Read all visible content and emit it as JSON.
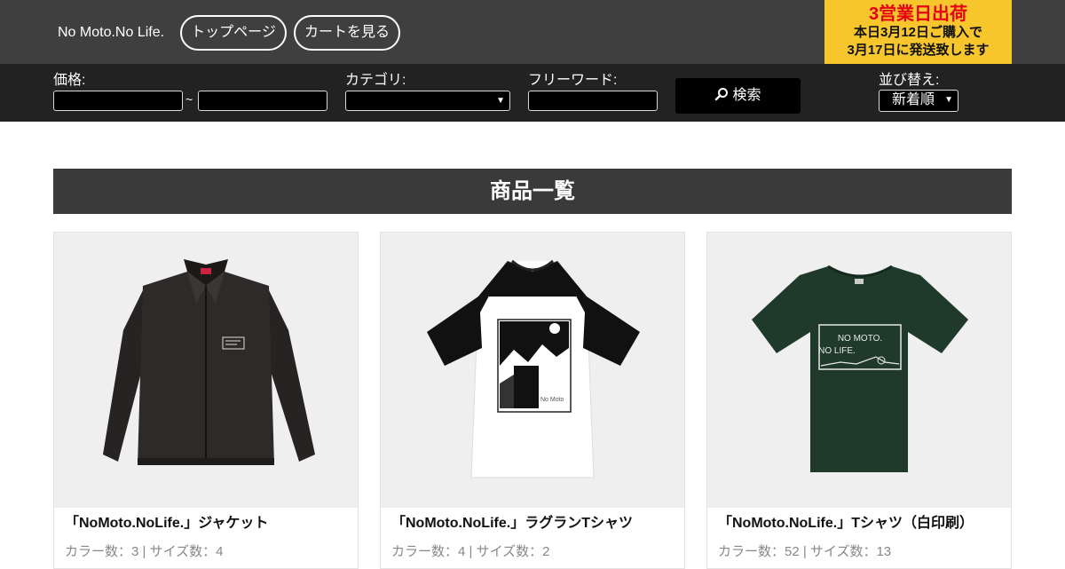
{
  "header": {
    "brand": "No Moto.No Life.",
    "nav": {
      "top_page": "トップページ",
      "view_cart": "カートを見る"
    },
    "promo": {
      "line1": "3営業日出荷",
      "line2": "本日3月12日ご購入で",
      "line3": "3月17日に発送致します"
    }
  },
  "search": {
    "price_label": "価格:",
    "price_separator": "~",
    "price_min_value": "",
    "price_max_value": "",
    "category_label": "カテゴリ:",
    "category_value": "",
    "freeword_label": "フリーワード:",
    "freeword_value": "",
    "search_button": "検索",
    "sort_label": "並び替え:",
    "sort_value": "新着順"
  },
  "main": {
    "section_title": "商品一覧",
    "products": [
      {
        "name": "「NoMoto.NoLife.」ジャケット",
        "meta": "カラー数：3 | サイズ数：4",
        "image_icon": "black-jacket-image"
      },
      {
        "name": "「NoMoto.NoLife.」ラグランTシャツ",
        "meta": "カラー数：4 | サイズ数：2",
        "image_icon": "raglan-tshirt-image"
      },
      {
        "name": "「NoMoto.NoLife.」Tシャツ（白印刷）",
        "meta": "カラー数：52 | サイズ数：13",
        "image_icon": "green-tshirt-image"
      }
    ]
  },
  "colors": {
    "header_bg": "#3f3f3f",
    "searchbar_bg": "#222222",
    "promo_bg": "#f6c62c",
    "promo_accent": "#e60012",
    "tshirt_green": "#1f3a2a"
  }
}
